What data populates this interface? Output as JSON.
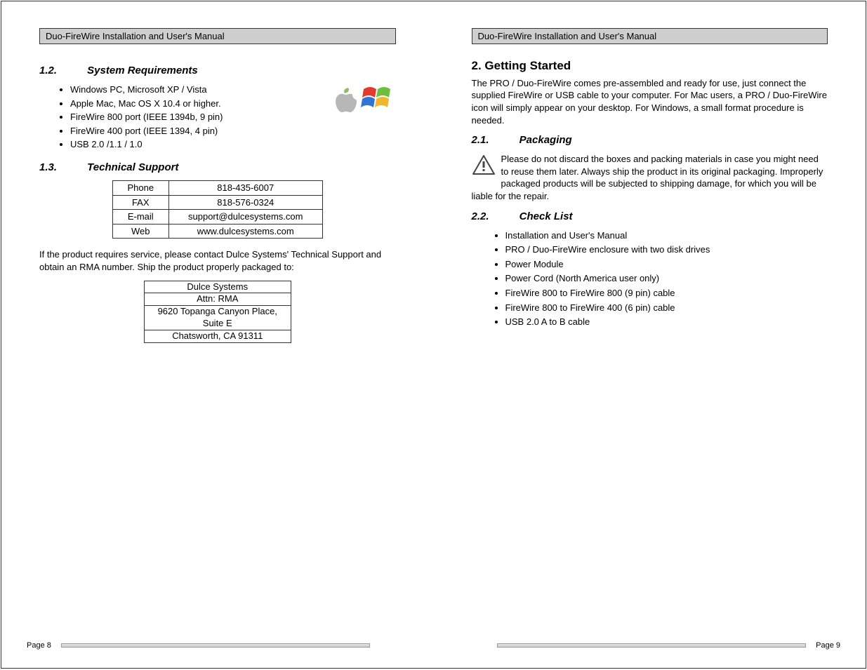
{
  "header": {
    "title": "Duo-FireWire Installation and User's Manual"
  },
  "left": {
    "s12": {
      "num": "1.2.",
      "title": "System Requirements"
    },
    "sysreq": [
      "Windows PC, Microsoft XP / Vista",
      "Apple Mac, Mac OS X 10.4 or higher.",
      "FireWire 800 port (IEEE 1394b, 9 pin)",
      "FireWire 400 port (IEEE 1394, 4 pin)",
      "USB 2.0 /1.1 / 1.0"
    ],
    "s13": {
      "num": "1.3.",
      "title": "Technical Support"
    },
    "contact": {
      "rows": [
        {
          "label": "Phone",
          "value": "818-435-6007"
        },
        {
          "label": "FAX",
          "value": "818-576-0324"
        },
        {
          "label": "E-mail",
          "value": "support@dulcesystems.com"
        },
        {
          "label": "Web",
          "value": "www.dulcesystems.com"
        }
      ]
    },
    "rma_text": "If the product requires service, please contact Dulce Systems' Technical Support and obtain an RMA number.  Ship the product properly packaged to:",
    "address": [
      "Dulce Systems",
      "Attn: RMA",
      "9620 Topanga Canyon Place,",
      "Suite E",
      "Chatsworth, CA  91311"
    ],
    "page_label": "Page 8"
  },
  "right": {
    "h2": "2. Getting Started",
    "intro": "The PRO / Duo-FireWire comes pre-assembled and ready for use, just connect the supplied FireWire or USB cable to your computer.  For Mac users, a PRO / Duo-FireWire icon will simply appear on your desktop.  For Windows, a small format procedure is needed.",
    "s21": {
      "num": "2.1.",
      "title": "Packaging"
    },
    "packaging_text": "Please do not discard the boxes and packing materials in case you might need to reuse them later.  Always ship the product in its original packaging.  Improperly packaged products will be subjected to shipping damage, for which you will be liable for the repair.",
    "s22": {
      "num": "2.2.",
      "title": "Check List"
    },
    "checklist": [
      "Installation and User's Manual",
      "PRO / Duo-FireWire enclosure with two disk drives",
      "Power Module",
      "Power Cord (North America user only)",
      "FireWire 800 to FireWire 800 (9 pin) cable",
      "FireWire 800 to FireWire 400 (6 pin) cable",
      "USB 2.0 A to B cable"
    ],
    "page_label": "Page 9"
  }
}
